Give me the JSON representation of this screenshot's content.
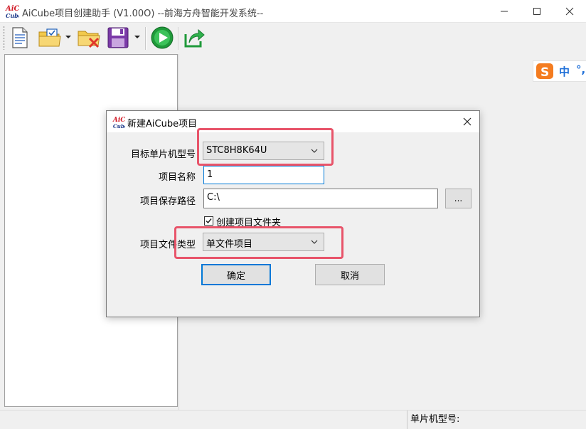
{
  "window": {
    "title": "AiCube项目创建助手 (V1.00O) --前海方舟智能开发系统--",
    "logo_text_top": "AiC",
    "logo_text_bottom": "Cube"
  },
  "toolbar": {
    "icons": [
      "new-document-icon",
      "open-project-icon",
      "close-project-icon",
      "save-icon",
      "run-icon",
      "export-icon"
    ]
  },
  "ime": {
    "mode": "中",
    "punct": "°,"
  },
  "dialog": {
    "title": "新建AiCube项目",
    "fields": {
      "target_mcu_label": "目标单片机型号",
      "target_mcu_value": "STC8H8K64U",
      "project_name_label": "项目名称",
      "project_name_value": "1",
      "save_path_label": "项目保存路径",
      "save_path_value": "C:\\",
      "browse_label": "...",
      "create_folder_label": "创建项目文件夹",
      "create_folder_checked": true,
      "file_type_label": "项目文件类型",
      "file_type_value": "单文件项目"
    },
    "ok_label": "确定",
    "cancel_label": "取消"
  },
  "status_bar": {
    "mcu_label": "单片机型号:"
  },
  "colors": {
    "highlight": "#e8546a",
    "focus": "#0078d7",
    "ime_blue": "#1e6fd8",
    "ime_orange": "#f47c20"
  }
}
